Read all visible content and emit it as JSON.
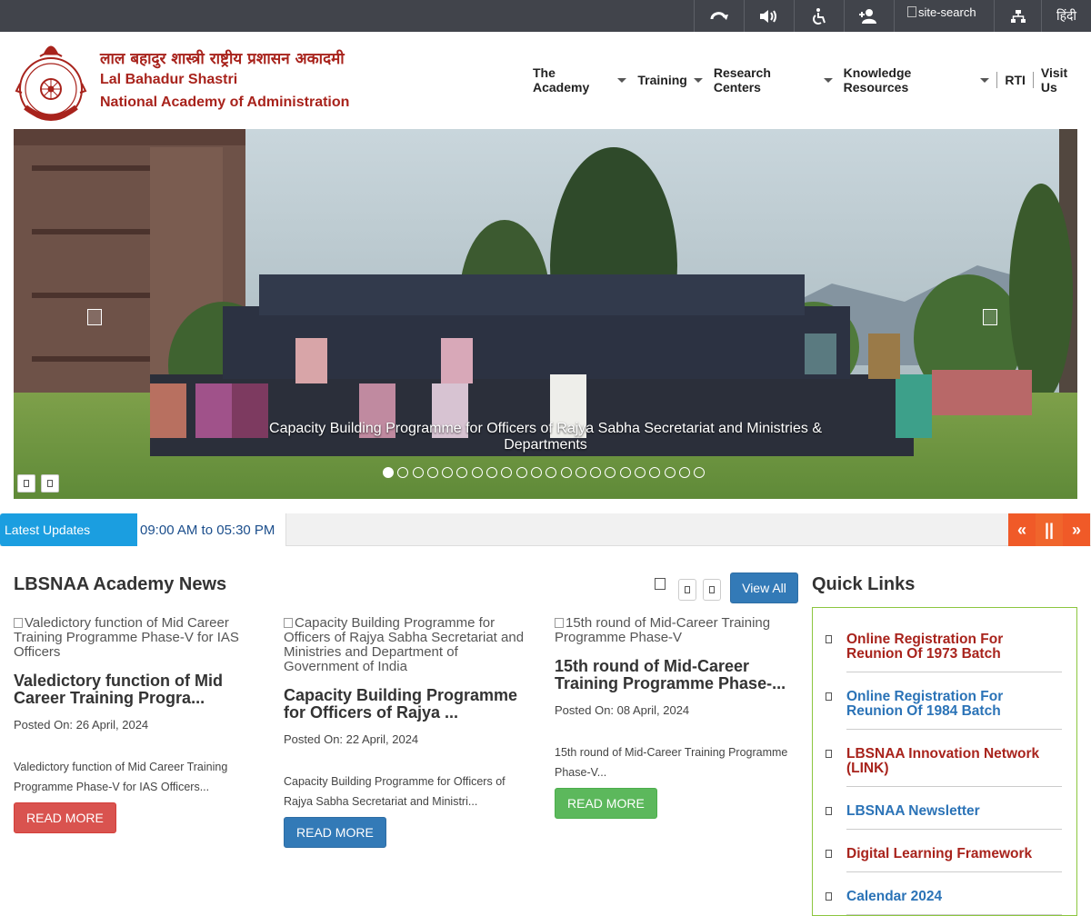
{
  "topbar": {
    "site_search_alt": "site-search",
    "language": "हिंदी"
  },
  "header": {
    "name_hindi": "लाल बहादुर शास्त्री राष्ट्रीय प्रशासन अकादमी",
    "name_line1": "Lal Bahadur Shastri",
    "name_line2": "National Academy of Administration"
  },
  "nav": {
    "items": [
      {
        "label": "The Academy",
        "dropdown": true
      },
      {
        "label": "Training",
        "dropdown": true
      },
      {
        "label": "Research Centers",
        "dropdown": true
      },
      {
        "label": "Knowledge Resources",
        "dropdown": true
      },
      {
        "label": "RTI",
        "dropdown": false
      },
      {
        "label": "Visit Us",
        "dropdown": false
      }
    ]
  },
  "hero": {
    "caption": "Capacity Building Programme for Officers of Rajya Sabha Secretariat and Ministries & Departments",
    "slide_count": 22,
    "active_slide": 1
  },
  "updates": {
    "label": "Latest Updates",
    "text": "09:00 AM to 05:30 PM",
    "prev": "«",
    "pause": "||",
    "next": "»"
  },
  "news": {
    "title": "LBSNAA Academy News",
    "view_all": "View All",
    "cards": [
      {
        "image_alt": "Valedictory function of Mid Career Training Programme Phase-V for IAS Officers",
        "title": "Valedictory function of Mid Career Training Progra...",
        "posted": "Posted On: 26 April, 2024",
        "excerpt": "Valedictory function of Mid Career Training Programme Phase-V for IAS Officers...",
        "button": "READ MORE",
        "button_color": "#d9534f"
      },
      {
        "image_alt": "Capacity Building Programme for Officers of Rajya Sabha Secretariat and Ministries and Department of Government of India",
        "title": "Capacity Building Programme for Officers of Rajya ...",
        "posted": "Posted On: 22 April, 2024",
        "excerpt": "Capacity Building Programme for Officers of Rajya Sabha Secretariat and Ministri...",
        "button": "READ MORE",
        "button_color": "#337ab7"
      },
      {
        "image_alt": "15th round of Mid-Career Training Programme Phase-V",
        "title": "15th round of Mid-Career Training Programme Phase-...",
        "posted": "Posted On: 08 April, 2024",
        "excerpt": "15th round of Mid-Career Training Programme Phase-V...",
        "button": "READ MORE",
        "button_color": "#5cb85c"
      }
    ]
  },
  "quick_links": {
    "title": "Quick Links",
    "items": [
      {
        "label": "Online Registration For Reunion Of 1973 Batch",
        "color": "#a8231c"
      },
      {
        "label": "Online Registration For Reunion Of 1984 Batch",
        "color": "#2b73b7"
      },
      {
        "label": "LBSNAA Innovation Network (LINK)",
        "color": "#a8231c"
      },
      {
        "label": "LBSNAA Newsletter",
        "color": "#2b73b7"
      },
      {
        "label": "Digital Learning Framework",
        "color": "#a8231c"
      },
      {
        "label": "Calendar 2024",
        "color": "#2b73b7"
      }
    ]
  }
}
